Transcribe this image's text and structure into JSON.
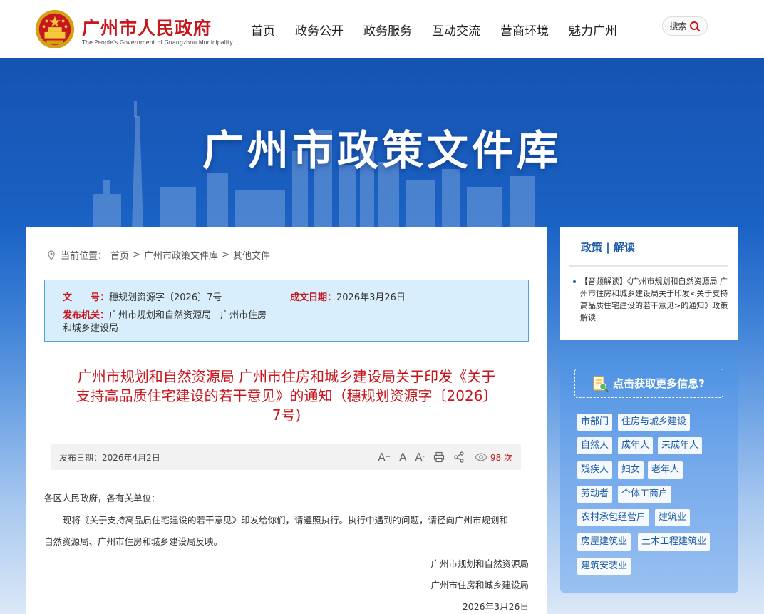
{
  "header": {
    "site_title": "广州市人民政府",
    "site_subtitle": "The People's Government of Guangzhou Municipality",
    "nav": [
      "首页",
      "政务公开",
      "政务服务",
      "互动交流",
      "营商环境",
      "魅力广州"
    ],
    "search_label": "搜索"
  },
  "banner": {
    "title": "广州市政策文件库"
  },
  "breadcrumb": {
    "prefix": "当前位置：",
    "items": [
      "首页",
      "广州市政策文件库",
      "其他文件"
    ],
    "sep": ">"
  },
  "meta": {
    "doc_no_key": "文　　号：",
    "doc_no": "穗规划资源字〔2026〕7号",
    "date_key": "成文日期：",
    "date": "2026年3月26日",
    "org_key": "发布机关：",
    "org_line1": "广州市规划和自然资源局　广州市住房",
    "org_line2": "和城乡建设局"
  },
  "document": {
    "title_line1": "广州市规划和自然资源局 广州市住房和城乡建设局关于印发《关于",
    "title_line2": "支持高品质住宅建设的若干意见》的通知（穗规划资源字〔2026〕",
    "title_line3": "7号)",
    "pub_date": "发布日期：2026年4月2日",
    "views": "98 次",
    "salutation": "各区人民政府，各有关单位：",
    "para_line1": "现将《关于支持高品质住宅建设的若干意见》印发给你们，请遵照执行。执行中遇到的问题，请径向广州市规划和",
    "para_line2": "自然资源局、广州市住房和城乡建设局反映。",
    "sign1": "广州市规划和自然资源局",
    "sign2": "广州市住房和城乡建设局",
    "sign_date": "2026年3月26日"
  },
  "sidebar": {
    "title": "政策 | 解读",
    "item": "【音频解读】《广州市规划和自然资源局 广州市住房和城乡建设局关于印发<关于支持高品质住宅建设的若干意见>的通知》政策解读",
    "more_title": "点击获取更多信息?",
    "tags": [
      "市部门",
      "住房与城乡建设",
      "自然人",
      "成年人",
      "未成年人",
      "残疾人",
      "妇女",
      "老年人",
      "劳动者",
      "个体工商户",
      "农村承包经营户",
      "建筑业",
      "房屋建筑业",
      "土木工程建筑业",
      "建筑安装业"
    ]
  },
  "colors": {
    "brand_red": "#c8161d",
    "brand_blue": "#1a5aa6",
    "meta_bg": "#d8eefc"
  }
}
